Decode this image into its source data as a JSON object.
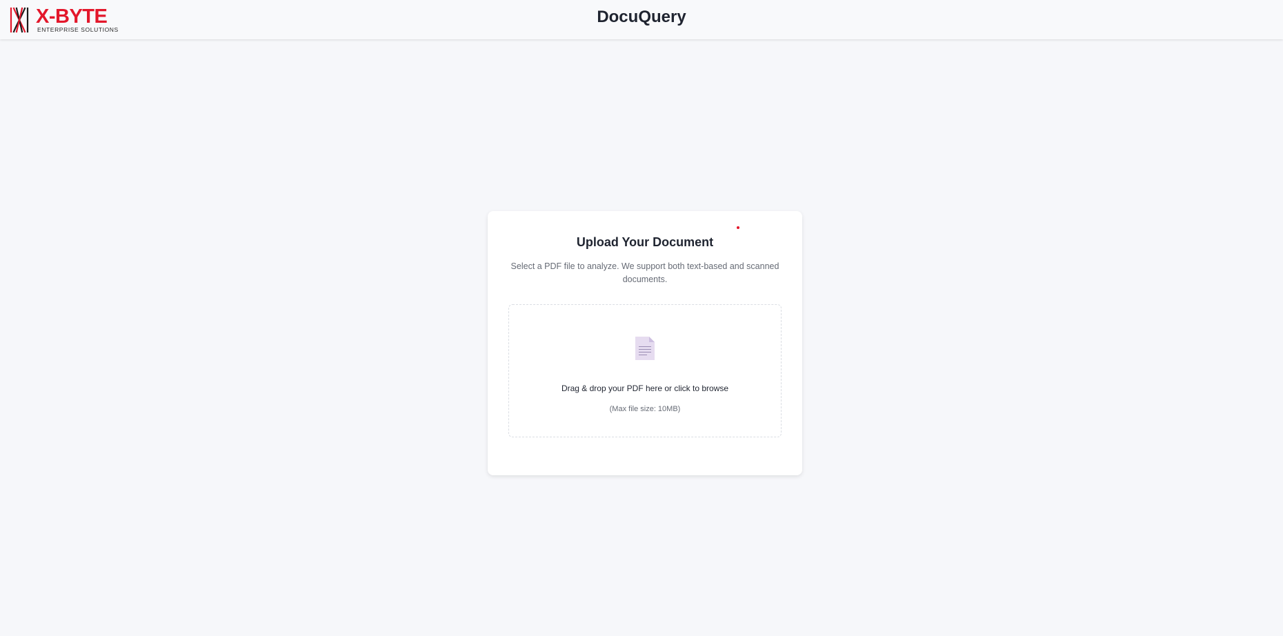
{
  "header": {
    "logo": {
      "brand": "X-BYTE",
      "tagline": "ENTERPRISE SOLUTIONS"
    },
    "app_title": "DocuQuery"
  },
  "upload_card": {
    "title": "Upload Your Document",
    "description": "Select a PDF file to analyze. We support both text-based and scanned documents.",
    "dropzone": {
      "icon": "document-icon",
      "prompt": "Drag & drop your PDF here or click to browse",
      "note": "(Max file size: 10MB)"
    }
  },
  "colors": {
    "brand_red": "#e3172b",
    "background": "#f6f7fa",
    "card": "#ffffff",
    "icon_purple": "#e6dcf0"
  }
}
